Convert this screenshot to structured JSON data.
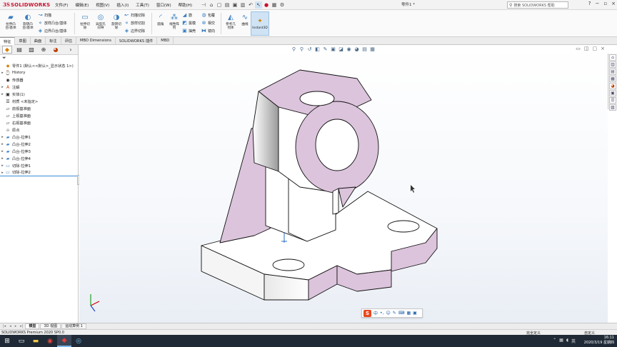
{
  "app": {
    "logo_ds": "3S",
    "logo_name": "SOLIDWORKS",
    "document_title": "零件1 *",
    "search_placeholder": "搜索 SOLIDWORKS 帮助"
  },
  "menus": [
    {
      "label": "文件(F)"
    },
    {
      "label": "编辑(E)"
    },
    {
      "label": "视图(V)"
    },
    {
      "label": "插入(I)"
    },
    {
      "label": "工具(T)"
    },
    {
      "label": "窗口(W)"
    },
    {
      "label": "帮助(H)"
    }
  ],
  "ribbon": {
    "extrude_boss": "拉伸凸\n台/基体",
    "revolve_boss": "旋转凸\n台/基体",
    "sweep": "扫描",
    "loft_boss": "放样凸台/基体",
    "boundary_boss": "边界凸台/基体",
    "extrude_cut": "拉伸切\n除",
    "hole_wizard": "异型孔\n向导",
    "revolve_cut": "旋转切\n除",
    "sweep_cut": "扫描切除",
    "loft_cut": "放样切割",
    "boundary_cut": "边界切除",
    "fillet": "圆角",
    "linear_pattern": "线性阵\n列",
    "rib": "筋",
    "draft": "拔模",
    "shell": "抽壳",
    "wrap": "包覆",
    "intersect": "相交",
    "mirror": "镜向",
    "ref_geometry": "参考几\n何体",
    "curves": "曲线",
    "instant3d": "Instant3D"
  },
  "command_tabs": [
    {
      "label": "特征",
      "active": true
    },
    {
      "label": "草图"
    },
    {
      "label": "曲面"
    },
    {
      "label": "标注"
    },
    {
      "label": "评估"
    },
    {
      "label": "MBD Dimensions"
    },
    {
      "label": "SOLIDWORKS 插件"
    },
    {
      "label": "MBD"
    }
  ],
  "feature_tree": {
    "root": "零件1  (默认<<默认>_显示状态 1>)",
    "items": [
      {
        "label": "History",
        "icon": "history-icon",
        "expand": "▸"
      },
      {
        "label": "传感器",
        "icon": "sensor-icon",
        "expand": ""
      },
      {
        "label": "注解",
        "icon": "annotation-icon",
        "expand": "▸"
      },
      {
        "label": "实体(1)",
        "icon": "solid-body-icon",
        "expand": "▸"
      },
      {
        "label": "材质 <未指定>",
        "icon": "material-icon",
        "expand": ""
      },
      {
        "label": "前视基准面",
        "icon": "plane-icon",
        "expand": ""
      },
      {
        "label": "上视基准面",
        "icon": "plane-icon",
        "expand": ""
      },
      {
        "label": "右视基准面",
        "icon": "plane-icon",
        "expand": ""
      },
      {
        "label": "原点",
        "icon": "origin-icon",
        "expand": ""
      },
      {
        "label": "凸台-拉伸1",
        "icon": "extrude-icon",
        "expand": "▸"
      },
      {
        "label": "凸台-拉伸2",
        "icon": "extrude-icon",
        "expand": "▸"
      },
      {
        "label": "凸台-拉伸3",
        "icon": "extrude-icon",
        "expand": "▸"
      },
      {
        "label": "凸台-拉伸4",
        "icon": "extrude-icon",
        "expand": "▸"
      },
      {
        "label": "切除-拉伸1",
        "icon": "cut-icon",
        "expand": "▸"
      },
      {
        "label": "切除-拉伸2",
        "icon": "cut-icon",
        "expand": "▸"
      }
    ]
  },
  "ime": {
    "badge": "S",
    "mode": "中"
  },
  "bottom_tabs": [
    {
      "label": "模型",
      "active": true
    },
    {
      "label": "3D 视图"
    },
    {
      "label": "运动算例 1"
    }
  ],
  "status": {
    "product": "SOLIDWORKS Premium 2020 SP0.0",
    "definition": "完全定义",
    "editing": "自定义"
  },
  "taskbar": {
    "time": "16:11",
    "date": "2020/3/19 星期四"
  },
  "colors": {
    "face_purple": "#dcc4dc",
    "face_white": "#ffffff",
    "accent": "#3b8fd6",
    "brand_red": "#c8102e"
  }
}
